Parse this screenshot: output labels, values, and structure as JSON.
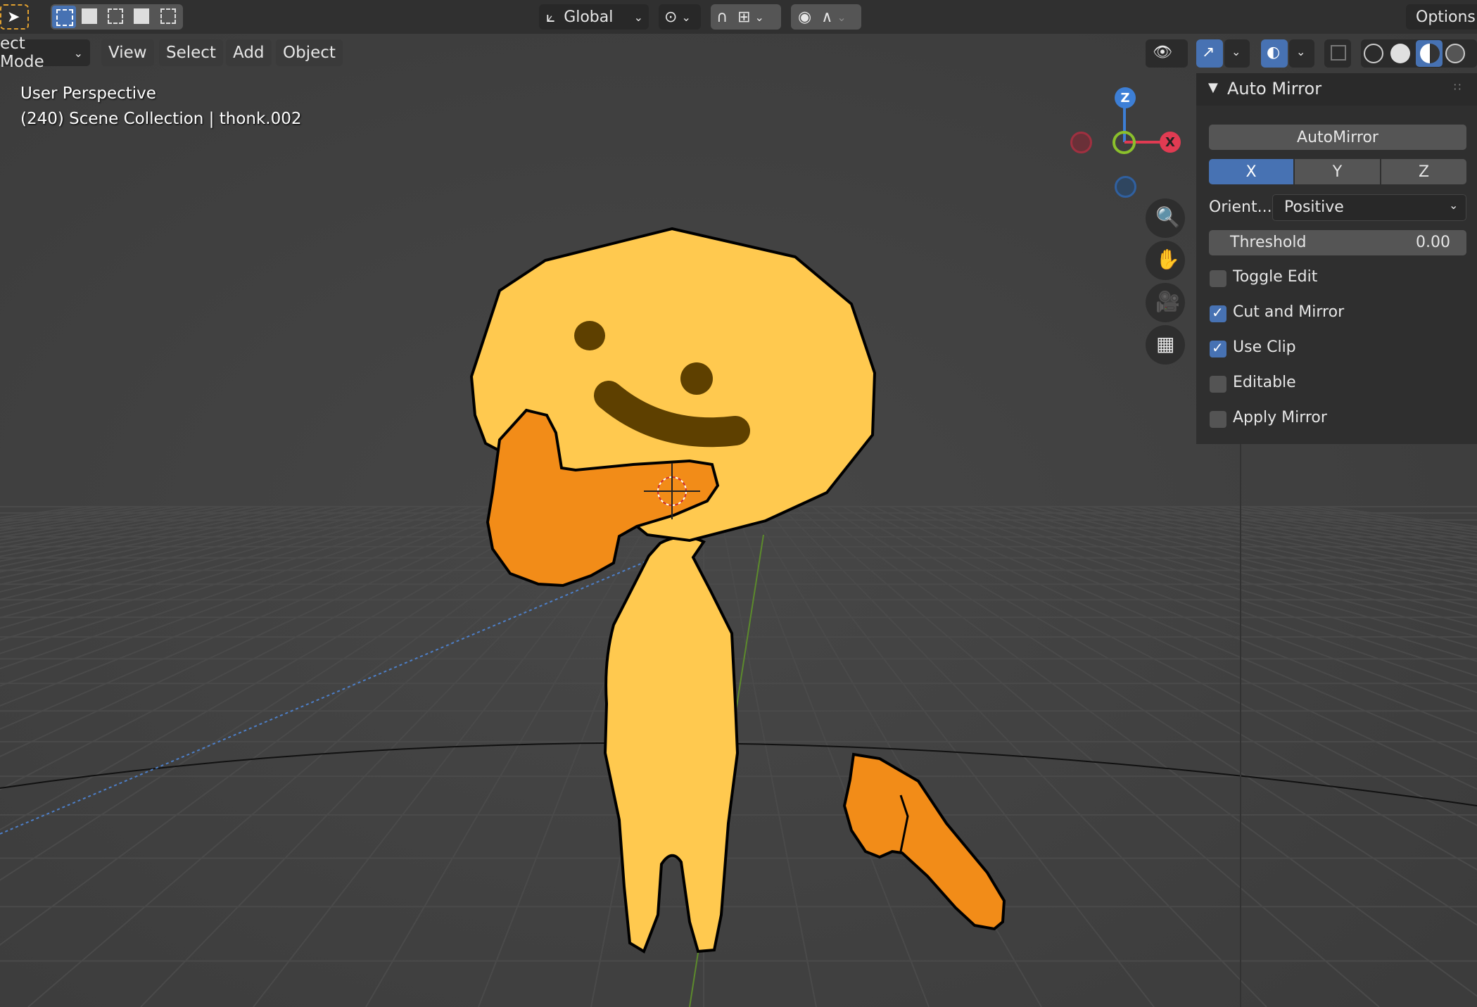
{
  "header": {
    "transform_orientation": "Global",
    "options_label": "Options"
  },
  "viewport_menu": {
    "mode_label": "ect Mode",
    "view": "View",
    "select": "Select",
    "add": "Add",
    "object": "Object"
  },
  "overlay": {
    "perspective": "User Perspective",
    "collection": "(240) Scene Collection | thonk.002"
  },
  "gizmo": {
    "z": "Z",
    "x": "X"
  },
  "panel": {
    "title": "Auto Mirror",
    "automirror_button": "AutoMirror",
    "axis": [
      "X",
      "Y",
      "Z"
    ],
    "axis_selected": "X",
    "orient_label": "Orient...",
    "orient_value": "Positive",
    "threshold_label": "Threshold",
    "threshold_value": "0.00",
    "options": [
      {
        "label": "Toggle Edit",
        "checked": false
      },
      {
        "label": "Cut and Mirror",
        "checked": true
      },
      {
        "label": "Use Clip",
        "checked": true
      },
      {
        "label": "Editable",
        "checked": false
      },
      {
        "label": "Apply Mirror",
        "checked": false
      }
    ]
  },
  "colors": {
    "accent": "#4772b3",
    "figure_yellow": "#ffc94f",
    "figure_orange": "#f28c18",
    "face_brown": "#5e4000",
    "axis_x": "#e03b52",
    "axis_y": "#8bc02c",
    "axis_z": "#3d7fd6"
  }
}
